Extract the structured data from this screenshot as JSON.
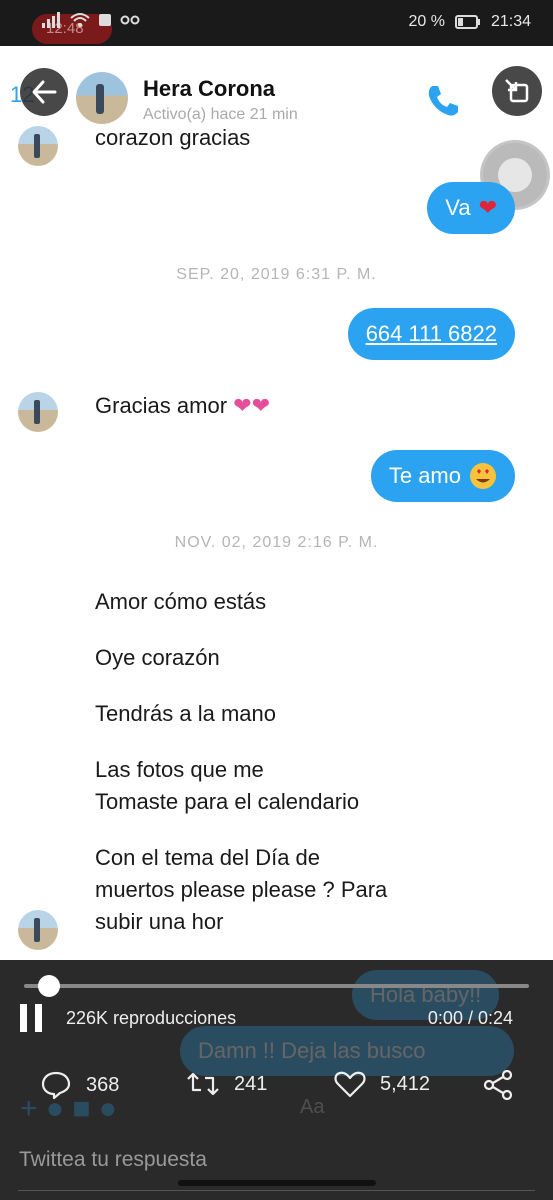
{
  "status_bar": {
    "recording_label": "12:48",
    "battery": "20 %",
    "clock": "21:34"
  },
  "chat": {
    "contact_name": "Hera Corona",
    "contact_status": "Activo(a) hace 21 min",
    "back_badge": "12",
    "messages": {
      "m1": "corazon gracias",
      "m2": "Va",
      "ts1": "SEP. 20, 2019 6:31 P. M.",
      "m3": "664 111 6822",
      "m4": "Gracias amor",
      "m5": "Te amo",
      "ts2": "NOV. 02, 2019 2:16 P. M.",
      "m6": "Amor cómo estás",
      "m7": "Oye corazón",
      "m8": "Tendrás a la mano",
      "m9a": "Las fotos que me",
      "m9b": "Tomaste para el calendario",
      "m10a": "Con el tema del Día de",
      "m10b": "muertos please please ? Para",
      "m10c": "subir una hor",
      "ghost1": "Hola baby!!",
      "ghost2": "Damn !! Deja las busco",
      "composer_placeholder": "Aa"
    }
  },
  "player": {
    "views": "226K reproducciones",
    "time": "0:00 / 0:24",
    "progress_fraction": 0.03
  },
  "tweet_actions": {
    "replies": "368",
    "retweets": "241",
    "likes": "5,412"
  },
  "reply_placeholder": "Twittea tu respuesta",
  "colors": {
    "messenger_blue": "#2ba3f0",
    "overlay_bg": "#2a2a2a"
  }
}
